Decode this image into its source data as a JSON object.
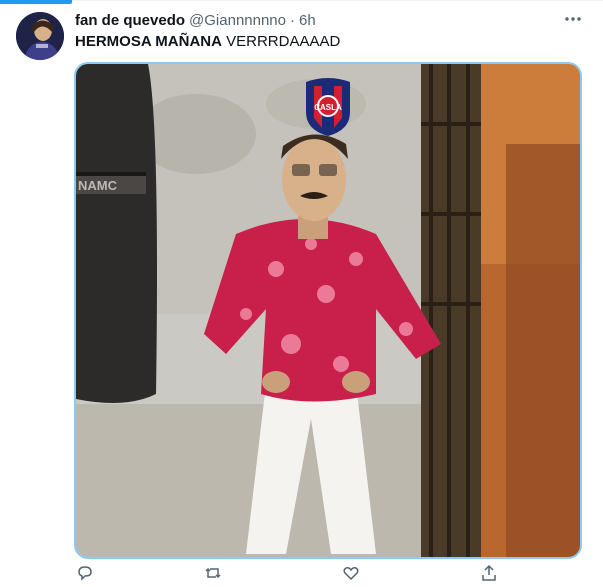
{
  "tweet": {
    "author_name": "fan de quevedo",
    "author_handle": "@Giannnnnno",
    "separator": "·",
    "timestamp": "6h",
    "text_bold": "HERMOSA MAÑANA",
    "text_rest": " VERRRDAAAAD",
    "avatar_icon": "user-avatar",
    "more_icon": "more-horizontal-icon"
  },
  "media": {
    "image_overlay_text": "NAMC",
    "logo_text": "CASLA"
  },
  "actions": [
    {
      "icon": "reply-icon"
    },
    {
      "icon": "retweet-icon"
    },
    {
      "icon": "like-icon"
    },
    {
      "icon": "share-icon"
    }
  ],
  "colors": {
    "accent": "#1d9bf0",
    "media_border": "#8ccaf4",
    "muted": "#536471"
  }
}
